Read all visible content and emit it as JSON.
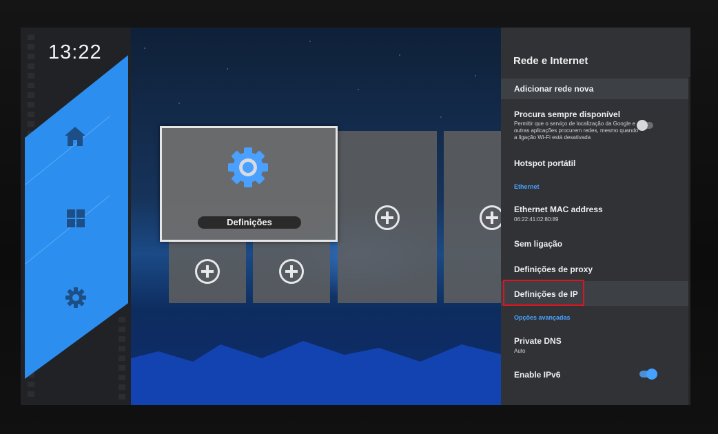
{
  "clock": "13:22",
  "launcher": {
    "nav": [
      {
        "name": "home-icon"
      },
      {
        "name": "apps-grid-icon"
      },
      {
        "name": "settings-gear-icon"
      }
    ]
  },
  "home": {
    "focused_tile": {
      "label": "Definições",
      "icon": "settings-gear-icon"
    },
    "empty_tile_icon": "add-circle-icon"
  },
  "panel": {
    "title": "Rede e Internet",
    "items": [
      {
        "label": "Adicionar rede nova"
      },
      {
        "label": "Procura sempre disponível",
        "sub": "Permitir que o serviço de localização da Google e outras aplicações procurem redes, mesmo quando a ligação Wi-Fi está desativada",
        "toggle": "off"
      },
      {
        "label": "Hotspot portátil"
      },
      {
        "label": "Ethernet MAC address",
        "sub": "06:22:41:02:80:89"
      },
      {
        "label": "Sem ligação"
      },
      {
        "label": "Definições de proxy"
      },
      {
        "label": "Definições de IP"
      },
      {
        "label": "Private DNS",
        "sub": "Auto"
      },
      {
        "label": "Enable IPv6",
        "toggle": "on"
      }
    ],
    "sections": [
      "Ethernet",
      "Opções avançadas"
    ]
  },
  "colors": {
    "accent": "#2c8ff0",
    "section_text": "#4aa3ff",
    "highlight_box": "#e0141e"
  }
}
